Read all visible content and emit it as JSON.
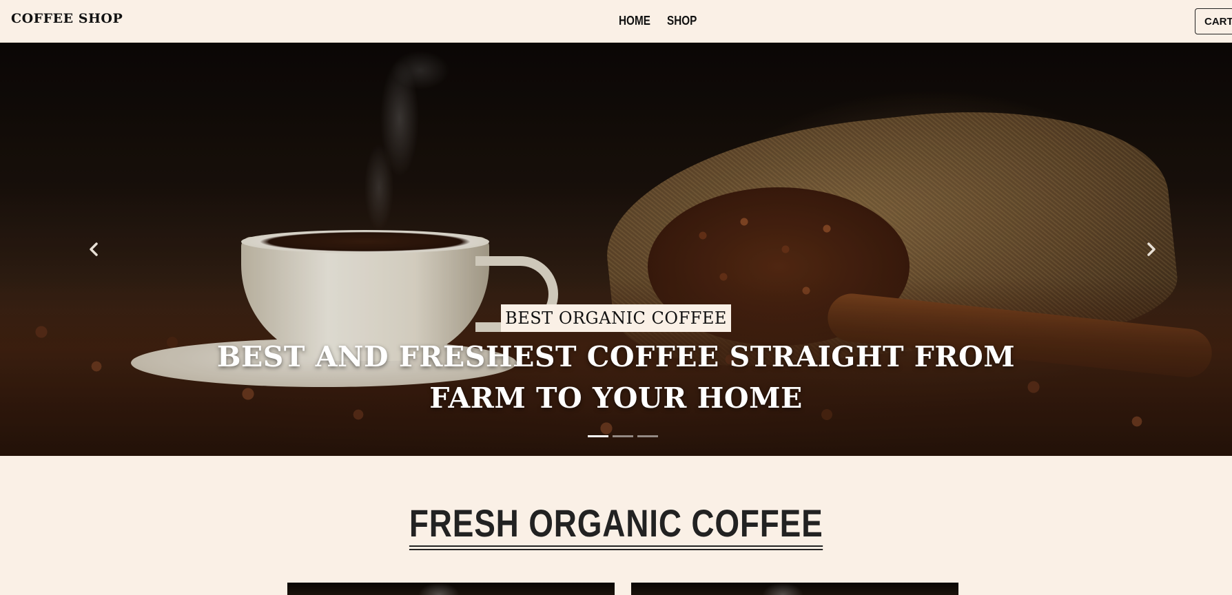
{
  "brand": "COFFEE SHOP",
  "nav": {
    "items": [
      {
        "label": "HOME"
      },
      {
        "label": "SHOP"
      }
    ],
    "cart_label": "CART"
  },
  "carousel": {
    "badge": "BEST ORGANIC COFFEE",
    "title": "BEST AND FRESHEST COFFEE STRAIGHT FROM FARM TO YOUR HOME",
    "slides_total": 3,
    "active_slide": 1,
    "prev_icon": "chevron-left-icon",
    "next_icon": "chevron-right-icon"
  },
  "section": {
    "title": "FRESH ORGANIC COFFEE"
  },
  "colors": {
    "page_background": "#faf0e6",
    "text_dark": "#222222",
    "caption_text": "#ffffff"
  }
}
